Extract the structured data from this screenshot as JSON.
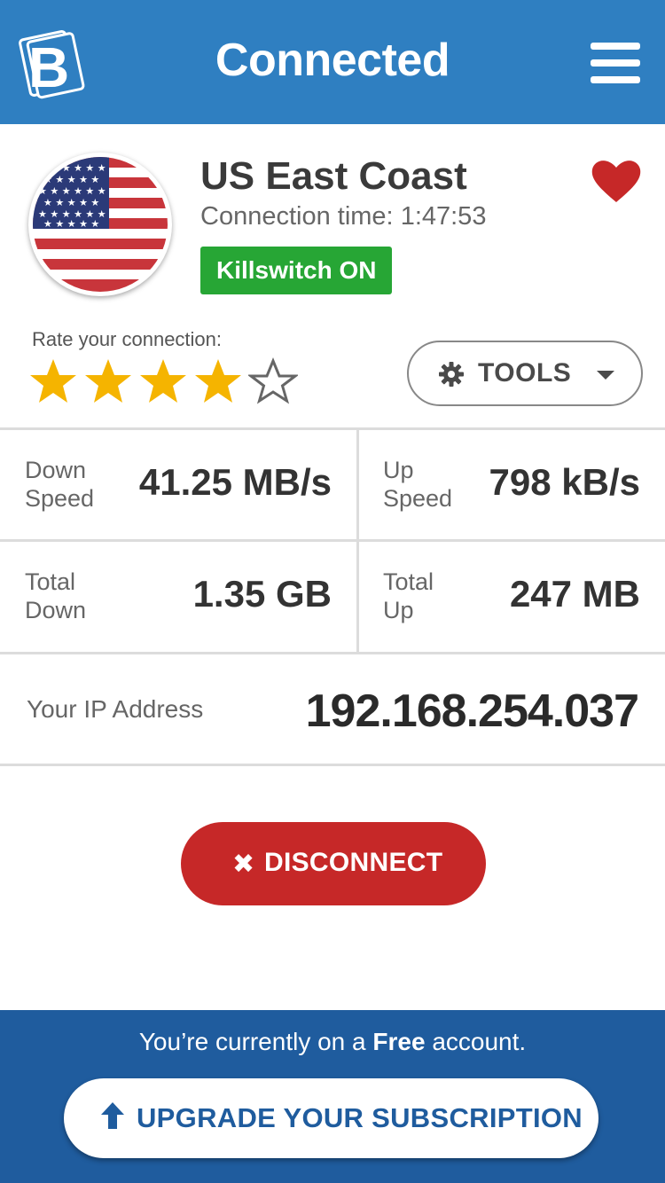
{
  "header": {
    "title": "Connected",
    "accent_color": "#2f7fc1",
    "logo_icon": "brand-b-logo",
    "menu_icon": "hamburger-menu-icon"
  },
  "server": {
    "name": "US East Coast",
    "connection_time_label": "Connection time:",
    "connection_time_value": "1:47:53",
    "killswitch_label": "Killswitch ON",
    "killswitch_color": "#27a635",
    "flag_icon": "us-flag-icon",
    "favorite_icon": "heart-icon",
    "favorite_color": "#c62828"
  },
  "rating": {
    "label": "Rate your connection:",
    "value": 4,
    "max": 5,
    "star_color": "#f5b400"
  },
  "tools": {
    "label": "TOOLS",
    "icon": "gear-icon"
  },
  "stats": {
    "down_speed": {
      "label_1": "Down",
      "label_2": "Speed",
      "value": "41.25 MB/s"
    },
    "up_speed": {
      "label_1": "Up",
      "label_2": "Speed",
      "value": "798 kB/s"
    },
    "total_down": {
      "label_1": "Total",
      "label_2": "Down",
      "value": "1.35 GB"
    },
    "total_up": {
      "label_1": "Total",
      "label_2": "Up",
      "value": "247 MB"
    }
  },
  "ip": {
    "label": "Your IP Address",
    "value": "192.168.254.037"
  },
  "disconnect": {
    "icon_glyph": "✖",
    "label": "DISCONNECT",
    "color": "#c62828"
  },
  "footer": {
    "text_before": "You’re currently on a ",
    "text_bold": "Free",
    "text_after": " account.",
    "upgrade_label": "UPGRADE YOUR SUBSCRIPTION",
    "upgrade_icon": "arrow-up-icon",
    "color": "#1f5c9e"
  }
}
